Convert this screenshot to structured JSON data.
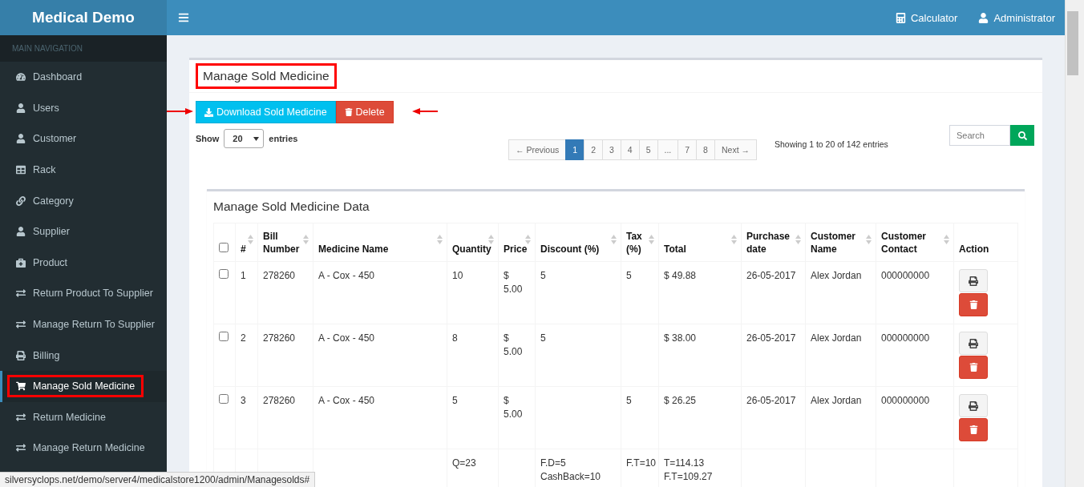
{
  "brand": "Medical Demo",
  "header": {
    "items": [
      {
        "label": "Calculator",
        "kind": "calculator"
      },
      {
        "label": "Administrator",
        "kind": "user"
      }
    ]
  },
  "sidebar": {
    "heading": "MAIN NAVIGATION",
    "items": [
      {
        "label": "Dashboard",
        "kind": "dashboard",
        "selected": false,
        "highlighted": false
      },
      {
        "label": "Users",
        "kind": "user",
        "selected": false,
        "highlighted": false
      },
      {
        "label": "Customer",
        "kind": "user",
        "selected": false,
        "highlighted": false
      },
      {
        "label": "Rack",
        "kind": "table",
        "selected": false,
        "highlighted": false
      },
      {
        "label": "Category",
        "kind": "link",
        "selected": false,
        "highlighted": false
      },
      {
        "label": "Supplier",
        "kind": "user",
        "selected": false,
        "highlighted": false
      },
      {
        "label": "Product",
        "kind": "medkit",
        "selected": false,
        "highlighted": false
      },
      {
        "label": "Return Product To Supplier",
        "kind": "exchange",
        "selected": false,
        "highlighted": false
      },
      {
        "label": "Manage Return To Supplier",
        "kind": "exchange",
        "selected": false,
        "highlighted": false
      },
      {
        "label": "Billing",
        "kind": "print",
        "selected": false,
        "highlighted": false
      },
      {
        "label": "Manage Sold Medicine",
        "kind": "cart",
        "selected": true,
        "highlighted": true
      },
      {
        "label": "Return Medicine",
        "kind": "exchange",
        "selected": false,
        "highlighted": false
      },
      {
        "label": "Manage Return Medicine",
        "kind": "exchange",
        "selected": false,
        "highlighted": false
      }
    ]
  },
  "page": {
    "title": "Manage Sold Medicine",
    "title_highlighted": true,
    "buttons": [
      {
        "label": "Download Sold Medicine",
        "kind": "download"
      },
      {
        "label": "Delete",
        "kind": "delete"
      }
    ],
    "length": {
      "before": "Show",
      "value": "20",
      "after": "entries"
    },
    "pagination": [
      {
        "label": "← Previous",
        "selected": false
      },
      {
        "label": "1",
        "selected": true
      },
      {
        "label": "2",
        "selected": false
      },
      {
        "label": "3",
        "selected": false
      },
      {
        "label": "4",
        "selected": false
      },
      {
        "label": "5",
        "selected": false
      },
      {
        "label": "...",
        "selected": false
      },
      {
        "label": "7",
        "selected": false
      },
      {
        "label": "8",
        "selected": false
      },
      {
        "label": "Next →",
        "selected": false
      }
    ],
    "info": "Showing 1 to 20 of 142 entries",
    "search": {
      "placeholder": "Search"
    },
    "table": {
      "title": "Manage Sold Medicine Data",
      "select_all": {
        "checked": false
      },
      "columns": [
        {
          "label": "#",
          "sortable": true
        },
        {
          "label": "Bill Number",
          "sortable": true
        },
        {
          "label": "Medicine Name",
          "sortable": true
        },
        {
          "label": "Quantity",
          "sortable": true
        },
        {
          "label": "Price",
          "sortable": true
        },
        {
          "label": "Discount (%)",
          "sortable": true
        },
        {
          "label": "Tax (%)",
          "sortable": true
        },
        {
          "label": "Total",
          "sortable": true
        },
        {
          "label": "Purchase date",
          "sortable": true
        },
        {
          "label": "Customer Name",
          "sortable": true
        },
        {
          "label": "Customer Contact",
          "sortable": true
        },
        {
          "label": "Action",
          "sortable": false
        }
      ],
      "rows": [
        {
          "checked": false,
          "number": "1",
          "bill_number": "278260",
          "medicine": "A - Cox - 450",
          "quantity": "10",
          "price": "$ 5.00",
          "discount": "5",
          "tax": "5",
          "total": "$ 49.88",
          "date": "26-05-2017",
          "customer": "Alex Jordan",
          "contact": "000000000",
          "actions": [
            {
              "kind": "print"
            },
            {
              "kind": "delete"
            }
          ]
        },
        {
          "checked": false,
          "number": "2",
          "bill_number": "278260",
          "medicine": "A - Cox - 450",
          "quantity": "8",
          "price": "$ 5.00",
          "discount": "5",
          "total": "$ 38.00",
          "date": "26-05-2017",
          "customer": "Alex Jordan",
          "contact": "000000000",
          "actions": [
            {
              "kind": "print"
            },
            {
              "kind": "delete"
            }
          ]
        },
        {
          "checked": false,
          "number": "3",
          "bill_number": "278260",
          "medicine": "A - Cox - 450",
          "quantity": "5",
          "price": "$ 5.00",
          "tax": "5",
          "total": "$ 26.25",
          "date": "26-05-2017",
          "customer": "Alex Jordan",
          "contact": "000000000",
          "actions": [
            {
              "kind": "print"
            },
            {
              "kind": "delete"
            }
          ]
        }
      ],
      "summary": {
        "quantity": [
          "Q=23"
        ],
        "discount": [
          "F.D=5",
          "CashBack=10"
        ],
        "tax": [
          "F.T=10"
        ],
        "total": [
          "T=114.13",
          "F.T=109.27"
        ]
      }
    }
  },
  "status_bar": {
    "url": "silversyclops.net/demo/server4/medicalstore1200/admin/Managesolds#"
  }
}
